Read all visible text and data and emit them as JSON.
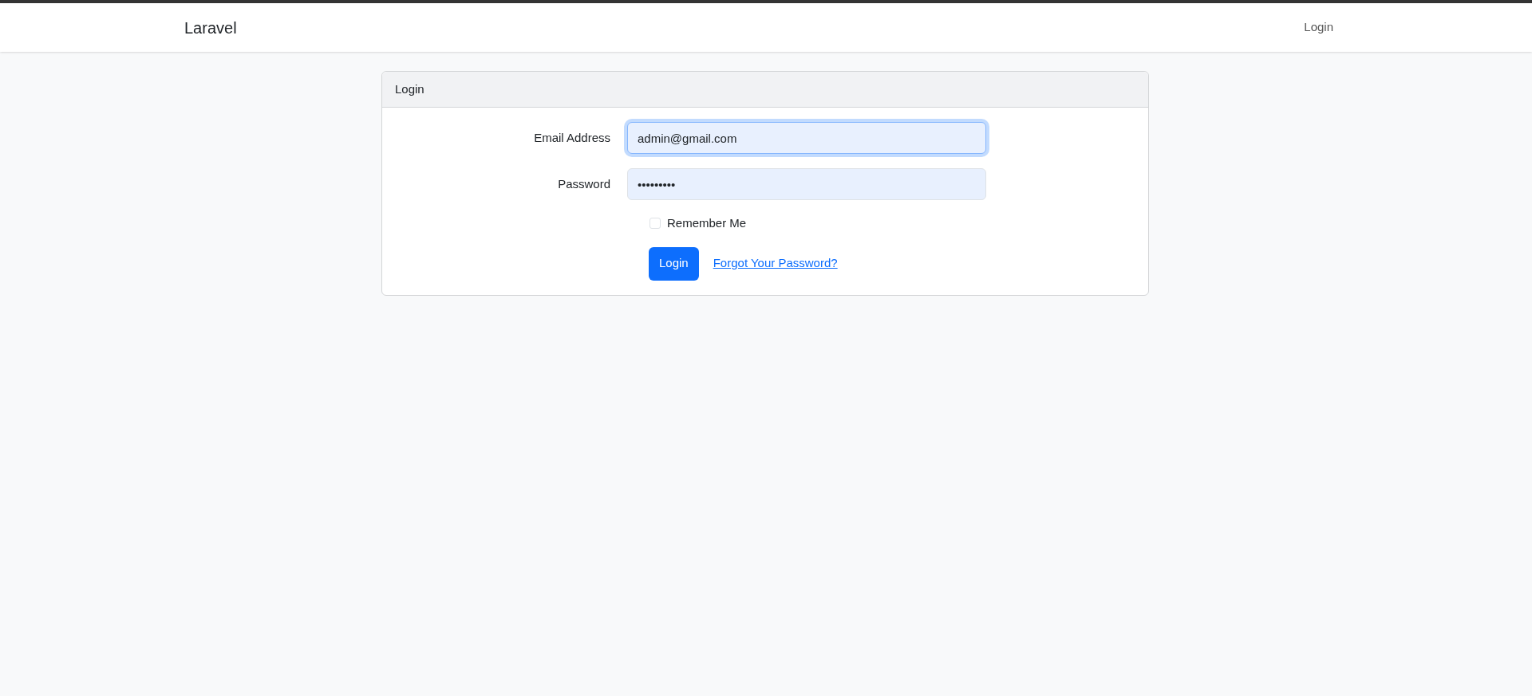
{
  "navbar": {
    "brand": "Laravel",
    "links": [
      "Login"
    ]
  },
  "card": {
    "title": "Login",
    "fields": [
      {
        "label": "Email Address",
        "value": "admin@gmail.com",
        "focused": true
      },
      {
        "label": "Password",
        "value": "•••••••••",
        "focused": false
      }
    ],
    "remember": {
      "label": "Remember Me",
      "checked": false
    },
    "submit": "Login",
    "forgot_link": "Forgot Your Password?"
  }
}
